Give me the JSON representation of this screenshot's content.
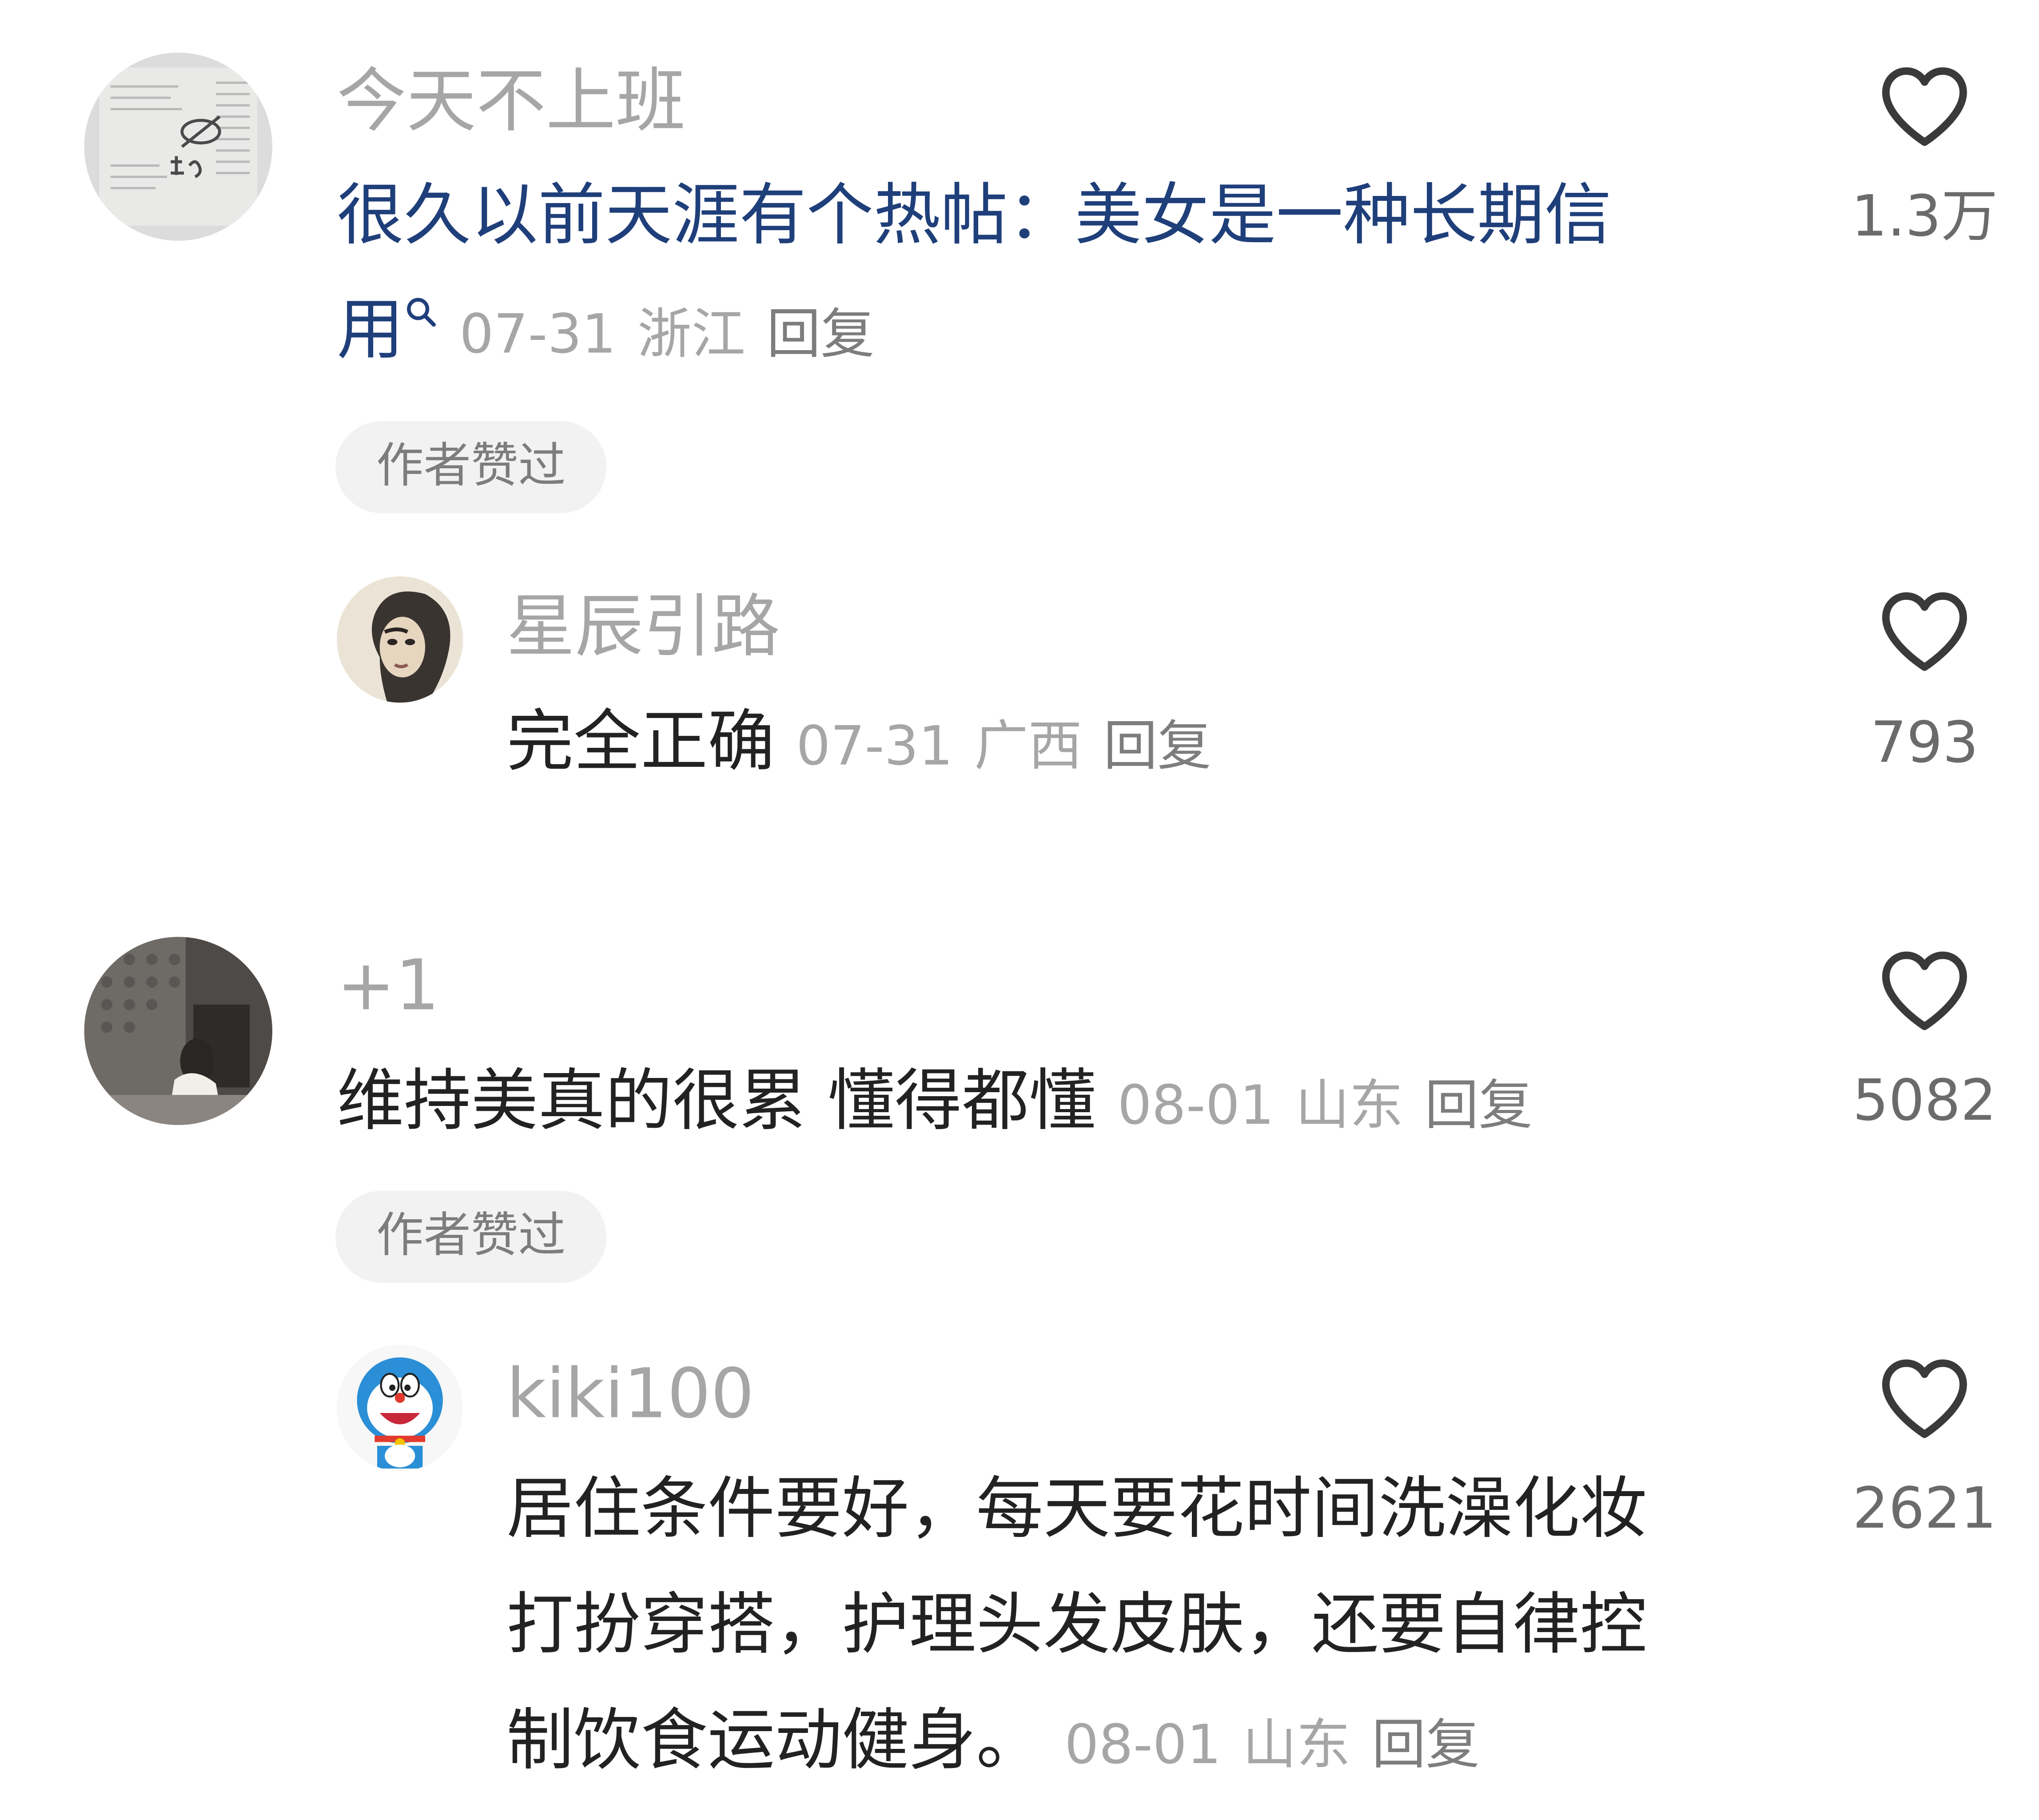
{
  "comments": [
    {
      "username": "今天不上班",
      "text_line1": "很久以前天涯有个热帖：美女是一种长期信",
      "text_line2": "用",
      "date": "07-31",
      "location": "浙江",
      "reply_label": "回复",
      "badge": "作者赞过",
      "likes": "1.3万",
      "icon": "search-icon",
      "reply": {
        "username": "星辰引路",
        "text": "完全正确",
        "date": "07-31",
        "location": "广西",
        "reply_label": "回复",
        "likes": "793"
      }
    },
    {
      "username": "+1",
      "text": "维持美真的很累 懂得都懂",
      "date": "08-01",
      "location": "山东",
      "reply_label": "回复",
      "badge": "作者赞过",
      "likes": "5082",
      "reply": {
        "username": "kiki100",
        "text_line1": "居住条件要好，每天要花时间洗澡化妆",
        "text_line2": "打扮穿搭，护理头发皮肤，还要自律控",
        "text_line3": "制饮食运动健身。",
        "date": "08-01",
        "location": "山东",
        "reply_label": "回复",
        "likes": "2621"
      }
    }
  ],
  "colors": {
    "username": "#a6a6a6",
    "text": "#222222",
    "link_text": "#1f3f7a",
    "meta": "#a6a6a6",
    "badge_bg": "#f2f2f2"
  }
}
